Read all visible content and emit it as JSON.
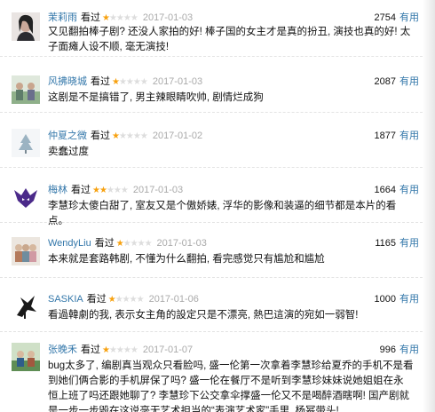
{
  "useful_label": "有用",
  "seen_label": "看过",
  "star_color": "#f7a10f",
  "link_color": "#3377aa",
  "comments": [
    {
      "user": "茉莉雨",
      "stars": 1,
      "date": "2017-01-03",
      "votes": "2754",
      "avatar": "photo-avatar",
      "text": "又见翻拍棒子剧? 还没人家拍的好! 棒子国的女主才是真的扮丑, 演技也真的好! 太子面瘫人设不顺, 毫无演技!"
    },
    {
      "user": "风拂晓城",
      "stars": 1,
      "date": "2017-01-03",
      "votes": "2087",
      "avatar": "photo-avatar",
      "text": "这剧是不是搞错了, 男主辣眼睛吹帅, 剧情烂成狗"
    },
    {
      "user": "仲夏之微",
      "stars": 1,
      "date": "2017-01-02",
      "votes": "1877",
      "avatar": "photo-avatar",
      "text": "卖蠢过度"
    },
    {
      "user": "梅林",
      "stars": 2,
      "date": "2017-01-03",
      "votes": "1664",
      "avatar": "wolf-logo-avatar",
      "text": "李慧珍太傻白甜了, 室友又是个傲娇婊, 浮华的影像和装逼的细节都是本片的看点。"
    },
    {
      "user": "WendyLiu",
      "stars": 1,
      "date": "2017-01-03",
      "votes": "1165",
      "avatar": "photo-avatar",
      "text": "本来就是套路韩剧, 不懂为什么翻拍, 看完感觉只有尴尬和尴尬"
    },
    {
      "user": "SASKIA",
      "stars": 1,
      "date": "2017-01-06",
      "votes": "1000",
      "avatar": "bird-silhouette-avatar",
      "text": "看過韓劇的我, 表示女主角的設定只是不漂亮, 熱巴這演的宛如一弱智!"
    },
    {
      "user": "张晚禾",
      "stars": 1,
      "date": "2017-01-07",
      "votes": "996",
      "avatar": "photo-avatar",
      "text": "bug太多了, 编剧真当观众只看脸吗, 盛一伦第一次拿着李慧珍给夏乔的手机不是看到她们俩合影的手机屏保了吗? 盛一伦在餐厅不是听到李慧珍妹妹说她姐姐在永恒上班了吗还跟她聊了? 李慧珍下公交拿伞撑盛一伦又不是喝醉酒瞎啊! 国产剧就是一步一步毁在这说毫无艺术担当的“表演艺术家”手里, 杨幂带头!"
    }
  ]
}
